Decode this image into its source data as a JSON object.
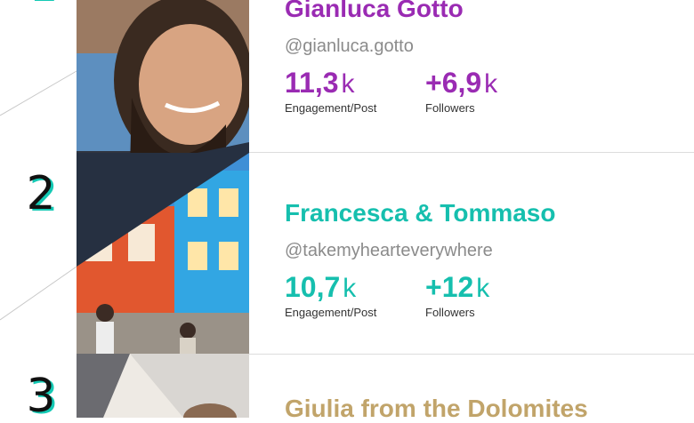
{
  "colors": {
    "purple": "#9a2bb3",
    "teal": "#16bfae",
    "gold": "#c1a46a",
    "rank_shadow": "#14c9b4"
  },
  "ranks": [
    {
      "label": "2"
    },
    {
      "label": "3"
    }
  ],
  "entries": [
    {
      "name": "Gianluca Gotto",
      "handle": "@gianluca.gotto",
      "engagement": {
        "value": "11,3",
        "unit": "k",
        "label": "Engagement/Post"
      },
      "followers": {
        "value": "+6,9",
        "unit": "k",
        "label": "Followers"
      }
    },
    {
      "name": "Francesca & Tommaso",
      "handle": "@takemyhearteverywhere",
      "engagement": {
        "value": "10,7",
        "unit": "k",
        "label": "Engagement/Post"
      },
      "followers": {
        "value": "+12",
        "unit": "k",
        "label": "Followers"
      }
    },
    {
      "name": "Giulia from the Dolomites"
    }
  ]
}
